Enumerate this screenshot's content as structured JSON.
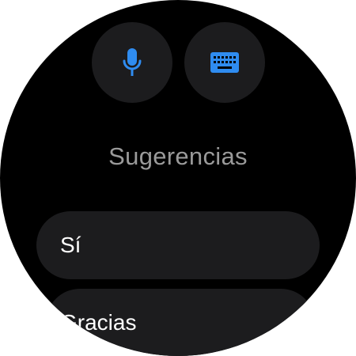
{
  "actions": {
    "voice_icon": "microphone-icon",
    "keyboard_icon": "keyboard-icon",
    "accent_color": "#2f8cf0"
  },
  "suggestions": {
    "title": "Sugerencias",
    "items": [
      {
        "label": "Sí"
      },
      {
        "label": "Gracias"
      }
    ]
  }
}
